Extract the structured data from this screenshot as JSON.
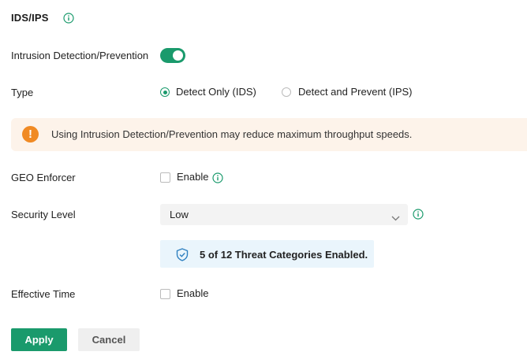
{
  "section": {
    "title": "IDS/IPS"
  },
  "ids": {
    "label": "Intrusion Detection/Prevention",
    "enabled": true
  },
  "type": {
    "label": "Type",
    "options": [
      "Detect Only (IDS)",
      "Detect and Prevent (IPS)"
    ],
    "selected": "Detect Only (IDS)"
  },
  "warning": {
    "text": "Using Intrusion Detection/Prevention may reduce maximum throughput speeds.",
    "icon": "!"
  },
  "geo": {
    "label": "GEO Enforcer",
    "checkbox_label": "Enable",
    "checked": false
  },
  "security": {
    "label": "Security Level",
    "value": "Low"
  },
  "threat": {
    "text": "5 of 12 Threat Categories Enabled."
  },
  "effective": {
    "label": "Effective Time",
    "checkbox_label": "Enable",
    "checked": false
  },
  "buttons": {
    "apply": "Apply",
    "cancel": "Cancel"
  },
  "colors": {
    "accent": "#1a9a6c",
    "warning": "#f08a24",
    "warning_bg": "#fdf3ea",
    "info_bg": "#eaf5fc",
    "shield": "#2f80c0"
  }
}
